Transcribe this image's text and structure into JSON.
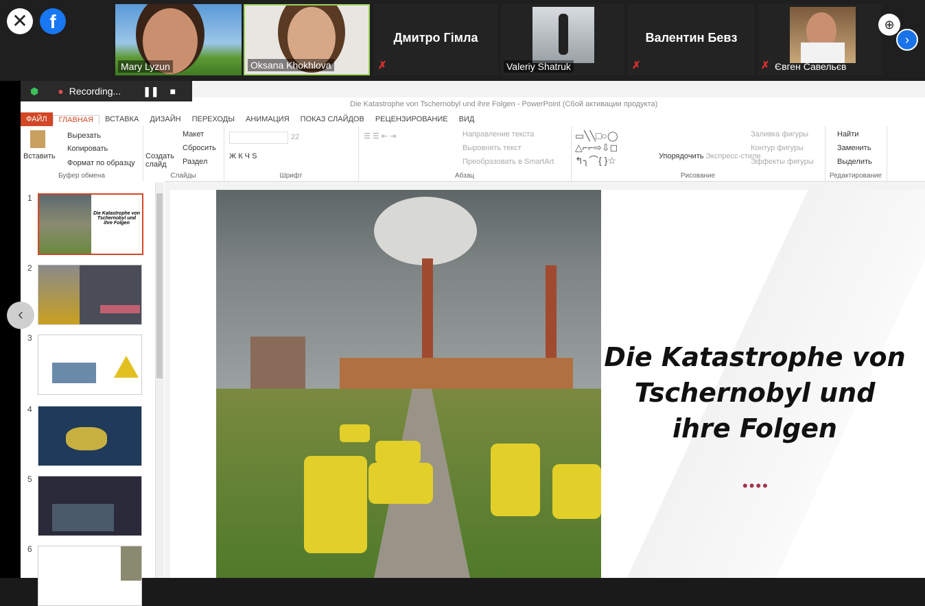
{
  "meeting": {
    "participants": [
      {
        "name": "Mary Lyzun",
        "video": true
      },
      {
        "name": "Oksana Khokhlova",
        "video": true
      },
      {
        "name": "Дмитро Гімла",
        "video": false
      },
      {
        "name": "Valeriy Shatruk",
        "video": true
      },
      {
        "name": "Валентин Бевз",
        "video": false
      },
      {
        "name": "Євген Савельєв",
        "video": true
      }
    ],
    "recording_label": "Recording...",
    "icons": [
      "close-icon",
      "facebook-icon",
      "zoom-in-icon",
      "next-icon",
      "shield-icon",
      "pause-icon",
      "stop-icon",
      "prev-slide-icon"
    ]
  },
  "ppt": {
    "window_title": "Die Katastrophe von Tschernobyl und ihre Folgen - PowerPoint (Сбой активации продукта)",
    "tabs": [
      "ФАЙЛ",
      "ГЛАВНАЯ",
      "ВСТАВКА",
      "ДИЗАЙН",
      "ПЕРЕХОДЫ",
      "АНИМАЦИЯ",
      "ПОКАЗ СЛАЙДОВ",
      "РЕЦЕНЗИРОВАНИЕ",
      "ВИД"
    ],
    "ribbon": {
      "clipboard": {
        "paste": "Вставить",
        "cut": "Вырезать",
        "copy": "Копировать",
        "format": "Формат по образцу",
        "label": "Буфер обмена"
      },
      "slides": {
        "new": "Создать слайд",
        "layout": "Макет",
        "reset": "Сбросить",
        "section": "Раздел",
        "label": "Слайды"
      },
      "font": {
        "size": "22",
        "label": "Шрифт"
      },
      "paragraph": {
        "direction": "Направление текста",
        "align": "Выровнять текст",
        "smartart": "Преобразовать в SmartArt",
        "label": "Абзац"
      },
      "drawing": {
        "arrange": "Упорядочить",
        "styles": "Экспресс-стили",
        "fill": "Заливка фигуры",
        "outline": "Контур фигуры",
        "effects": "Эффекты фигуры",
        "label": "Рисование"
      },
      "editing": {
        "find": "Найти",
        "replace": "Заменить",
        "select": "Выделить",
        "label": "Редактирование"
      }
    },
    "thumbnails": [
      {
        "num": "1",
        "text": "Die Katastrophe von Tschernobyl und ihre Folgen"
      },
      {
        "num": "2",
        "text": ""
      },
      {
        "num": "3",
        "text": ""
      },
      {
        "num": "4",
        "text": ""
      },
      {
        "num": "5",
        "text": ""
      },
      {
        "num": "6",
        "text": ""
      }
    ],
    "slide": {
      "title_line1": "Die Katastrophe von",
      "title_line2": "Tschernobyl und",
      "title_line3": "ihre Folgen",
      "dots": "••••"
    }
  },
  "colors": {
    "accent": "#d24726",
    "dots": "#a0344a",
    "barrel": "#e2cf2a",
    "zoom_blue": "#1a73e8"
  }
}
